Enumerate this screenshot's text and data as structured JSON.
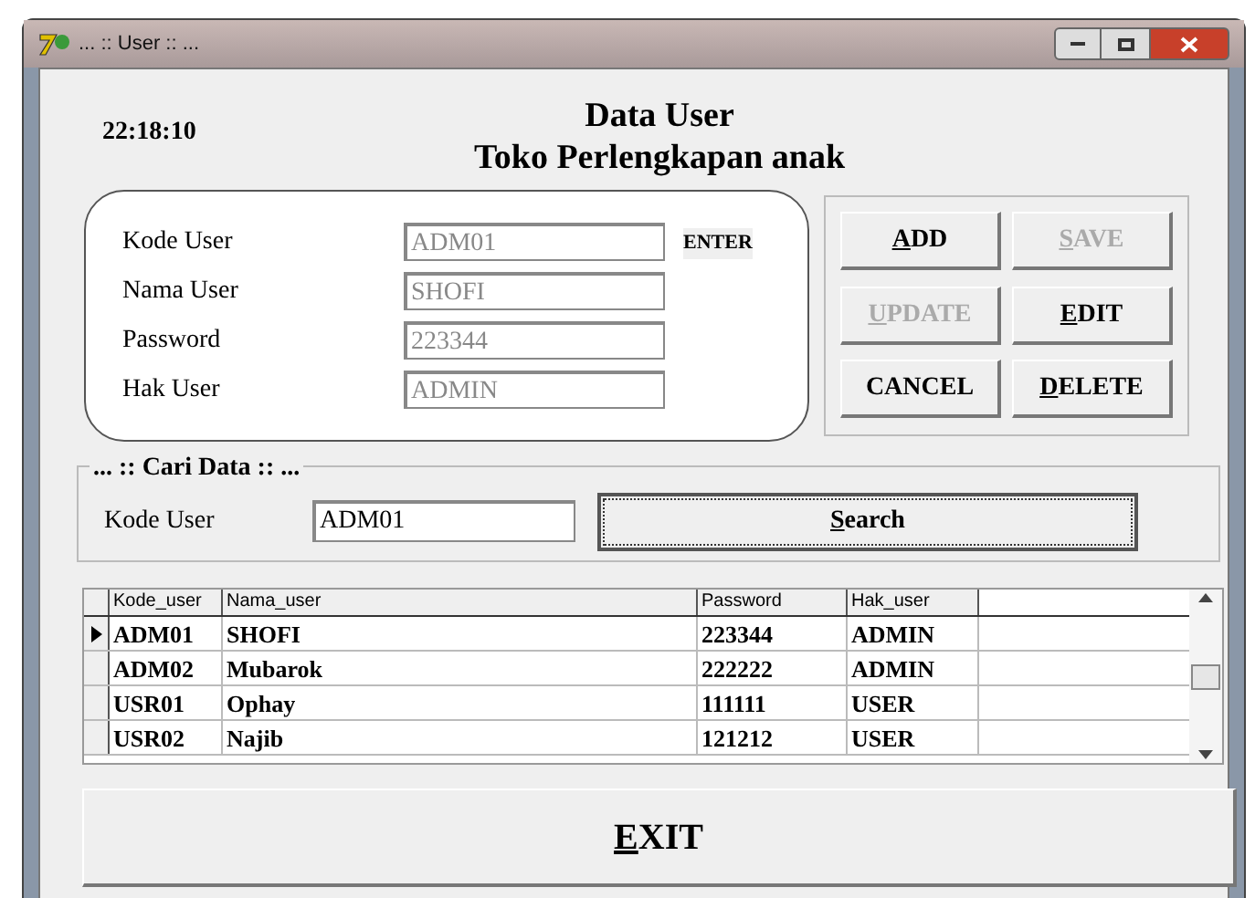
{
  "window": {
    "title": "... :: User :: ..."
  },
  "clock": "22:18:10",
  "heading": [
    "Data User",
    "Toko Perlengkapan anak"
  ],
  "form": {
    "fields": [
      {
        "label": "Kode User",
        "value": "ADM01",
        "disabled": true
      },
      {
        "label": "Nama User",
        "value": "SHOFI",
        "disabled": true
      },
      {
        "label": "Password",
        "value": "223344",
        "disabled": true
      },
      {
        "label": "Hak User",
        "value": "ADMIN",
        "disabled": true
      }
    ],
    "enter_label": "ENTER"
  },
  "buttons": [
    {
      "accel": "A",
      "rest": "DD",
      "disabled": false
    },
    {
      "accel": "S",
      "rest": "AVE",
      "disabled": true
    },
    {
      "accel": "U",
      "rest": "PDATE",
      "disabled": true
    },
    {
      "accel": "E",
      "rest": "DIT",
      "disabled": false
    },
    {
      "rest": "CANCEL",
      "disabled": false
    },
    {
      "accel": "D",
      "rest": "ELETE",
      "disabled": false
    }
  ],
  "search": {
    "title": "... :: Cari Data :: ...",
    "label": "Kode User",
    "value": "ADM01",
    "button": {
      "accel": "S",
      "rest": "earch"
    }
  },
  "table": {
    "columns": [
      "Kode_user",
      "Nama_user",
      "Password",
      "Hak_user"
    ],
    "rows": [
      {
        "cells": [
          "ADM01",
          "SHOFI",
          "223344",
          "ADMIN"
        ],
        "selected": true
      },
      {
        "cells": [
          "ADM02",
          "Mubarok",
          "222222",
          "ADMIN"
        ],
        "selected": false
      },
      {
        "cells": [
          "USR01",
          "Ophay",
          "111111",
          "USER"
        ],
        "selected": false
      },
      {
        "cells": [
          "USR02",
          "Najib",
          "121212",
          "USER"
        ],
        "selected": false
      }
    ]
  },
  "exit_button": {
    "accel": "E",
    "rest": "XIT"
  }
}
